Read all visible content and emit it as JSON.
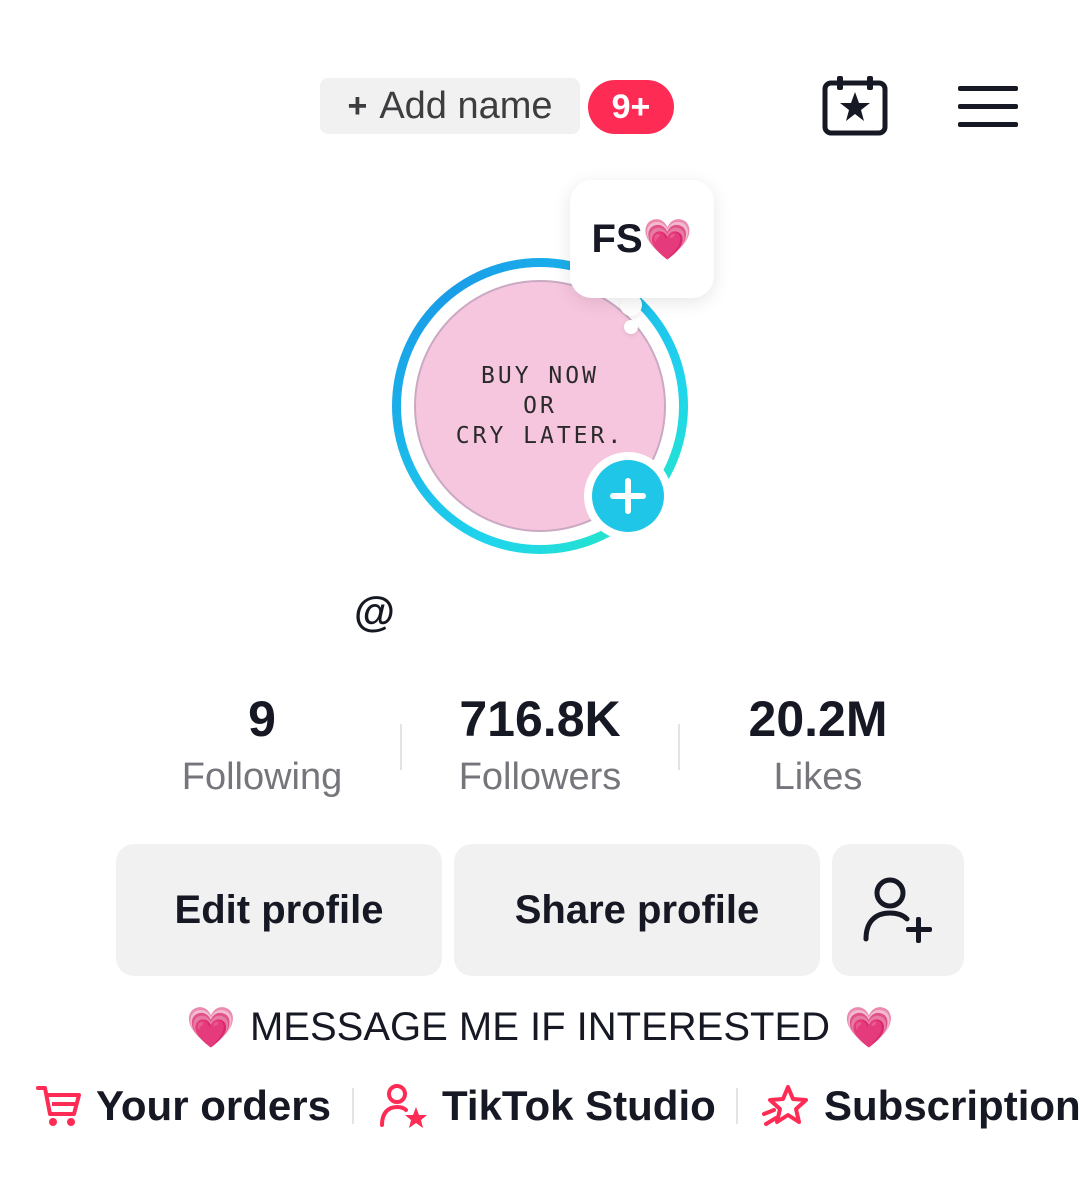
{
  "header": {
    "add_name_label": "Add name",
    "add_name_plus": "+",
    "notification_badge": "9+",
    "calendar_icon": "calendar-star-icon",
    "menu_icon": "hamburger-menu-icon"
  },
  "avatar": {
    "lines": [
      "BUY NOW",
      "OR",
      "CRY LATER."
    ],
    "ring_colors": [
      "#20d5ec",
      "#1a9ce8",
      "#25e6c8"
    ],
    "add_icon": "plus-icon"
  },
  "note": {
    "text": "FS",
    "emoji": "💗"
  },
  "profile": {
    "handle": "@"
  },
  "stats": [
    {
      "value": "9",
      "label": "Following"
    },
    {
      "value": "716.8K",
      "label": "Followers"
    },
    {
      "value": "20.2M",
      "label": "Likes"
    }
  ],
  "actions": {
    "edit_profile": "Edit profile",
    "share_profile": "Share profile",
    "add_friend_icon": "add-friend-icon"
  },
  "bio": {
    "text": "MESSAGE ME IF INTERESTED",
    "emoji_left": "💗",
    "emoji_right": "💗"
  },
  "links": [
    {
      "label": "Your orders",
      "icon": "cart-icon"
    },
    {
      "label": "TikTok Studio",
      "icon": "creator-star-icon"
    },
    {
      "label": "Subscription",
      "icon": "subscription-star-icon"
    }
  ],
  "colors": {
    "accent_red": "#fe2c55",
    "accent_cyan": "#20c6e8",
    "button_bg": "#f1f1f2",
    "muted_text": "#75757b"
  }
}
